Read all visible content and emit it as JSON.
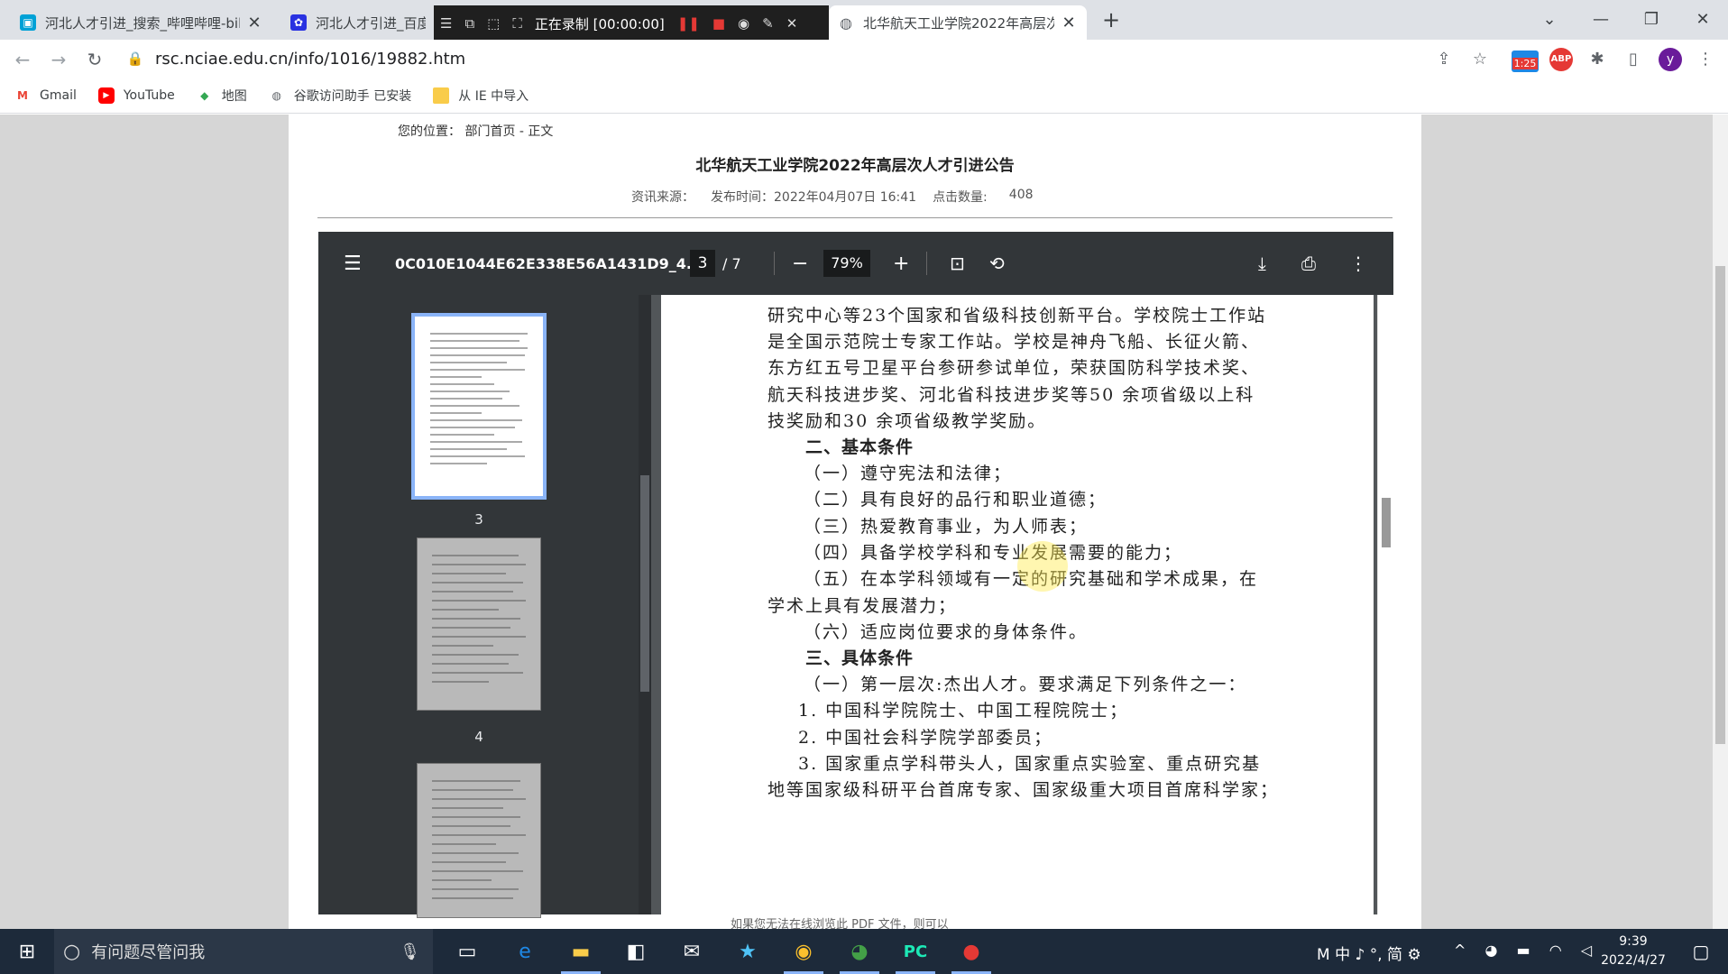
{
  "tabs": [
    {
      "title": "河北人才引进_搜索_哔哩哔哩-bili",
      "icon": "bilibili-icon",
      "color": "#00a1d6"
    },
    {
      "title": "河北人才引进_百度",
      "icon": "baidu-icon",
      "color": "#2932e1"
    },
    {
      "title": "北华航天工业学院2022年高层次",
      "icon": "globe-icon",
      "color": "#5f6368"
    }
  ],
  "recorder": {
    "label": "正在录制 [00:00:00]"
  },
  "address": {
    "url": "rsc.nciae.edu.cn/info/1016/19882.htm",
    "ext_badge": "1:25"
  },
  "bookmarks": [
    {
      "label": "Gmail",
      "icon": "gmail-icon"
    },
    {
      "label": "YouTube",
      "icon": "youtube-icon"
    },
    {
      "label": "地图",
      "icon": "maps-icon"
    },
    {
      "label": "谷歌访问助手 已安装",
      "icon": "globe-icon"
    },
    {
      "label": "从 IE 中导入",
      "icon": "folder-icon"
    }
  ],
  "article": {
    "breadcrumb_label": "您的位置：",
    "breadcrumb": "部门首页 - 正文",
    "title": "北华航天工业学院2022年高层次人才引进公告",
    "source": "资讯来源：",
    "published": "发布时间：2022年04月07日 16:41",
    "clicks_label": "点击数量:",
    "clicks": "408",
    "footer_note": "如果您无法在线浏览此 PDF 文件，则可以"
  },
  "pdf": {
    "filename": "0C010E1044E62E338E56A1431D9_4...",
    "page": "3",
    "total": "/  7",
    "zoom": "79%",
    "thumb_labels": [
      "3",
      "4"
    ],
    "lines": [
      "研究中心等23个国家和省级科技创新平台。学校院士工作站",
      "是全国示范院士专家工作站。学校是神舟飞船、长征火箭、",
      "东方红五号卫星平台参研参试单位，荣获国防科学技术奖、",
      "航天科技进步奖、河北省科技进步奖等50 余项省级以上科",
      "技奖励和30 余项省级教学奖励。",
      "二、基本条件",
      "（一）遵守宪法和法律；",
      "（二）具有良好的品行和职业道德；",
      "（三）热爱教育事业，为人师表；",
      "（四）具备学校学科和专业发展需要的能力；",
      "（五）在本学科领域有一定的研究基础和学术成果，在",
      "学术上具有发展潜力；",
      "（六）适应岗位要求的身体条件。",
      "三、具体条件",
      "（一）第一层次:杰出人才。要求满足下列条件之一：",
      "1. 中国科学院院士、中国工程院院士；",
      "2. 中国社会科学院学部委员；",
      "3. 国家重点学科带头人，国家重点实验室、重点研究基",
      "地等国家级科研平台首席专家、国家级重大项目首席科学家；"
    ]
  },
  "taskbar": {
    "search_placeholder": "有问题尽管问我",
    "ime": "M 中 ♪ °, 简 ⚙",
    "time": "9:39",
    "date": "2022/4/27",
    "avatar_letter": "y"
  }
}
